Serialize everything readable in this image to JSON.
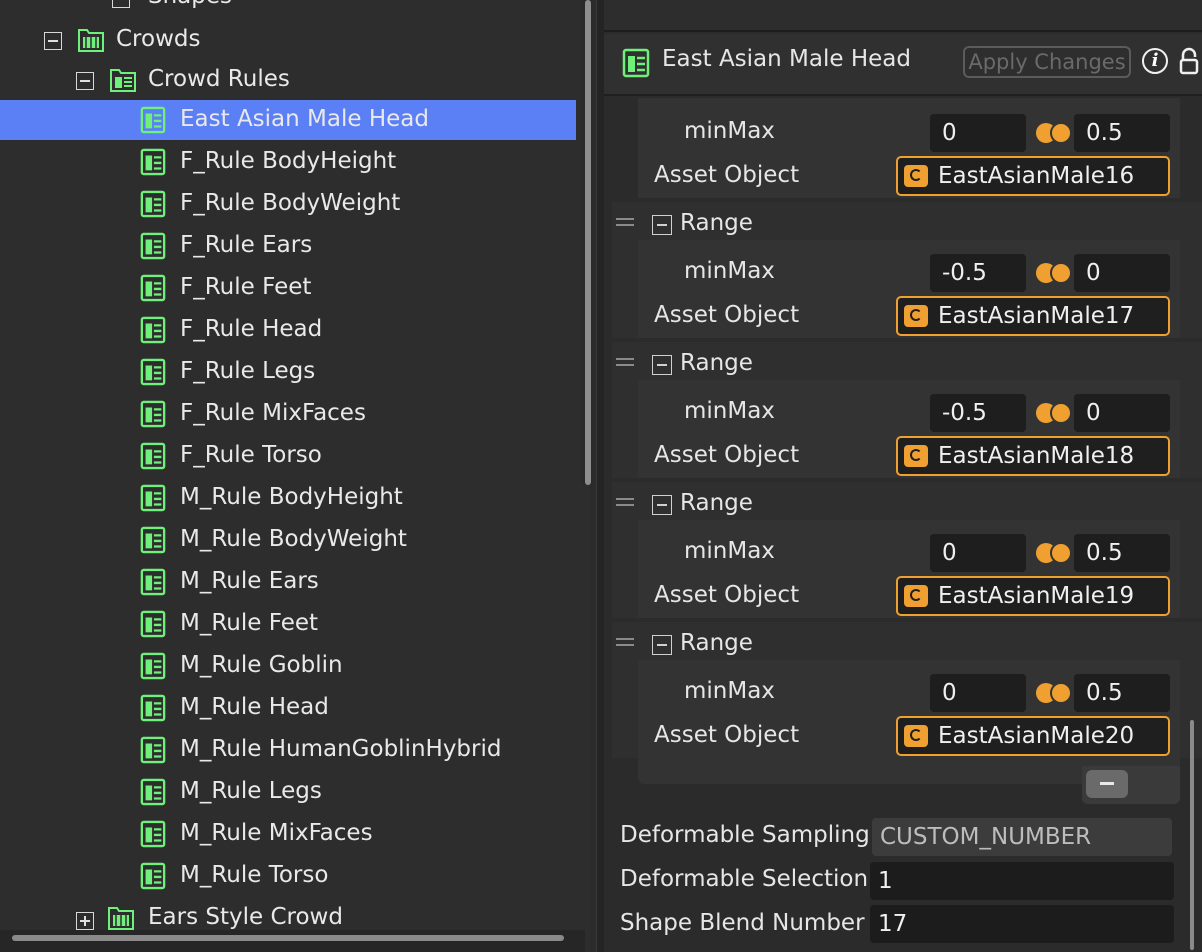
{
  "tree": {
    "partial_top_label": "Shapes",
    "crowds_label": "Crowds",
    "crowd_rules_label": "Crowd Rules",
    "items": [
      "East Asian Male Head",
      "F_Rule BodyHeight",
      "F_Rule BodyWeight",
      "F_Rule Ears",
      "F_Rule Feet",
      "F_Rule Head",
      "F_Rule Legs",
      "F_Rule MixFaces",
      "F_Rule Torso",
      "M_Rule BodyHeight",
      "M_Rule BodyWeight",
      "M_Rule Ears",
      "M_Rule Feet",
      "M_Rule Goblin",
      "M_Rule Head",
      "M_Rule HumanGoblinHybrid",
      "M_Rule Legs",
      "M_Rule MixFaces",
      "M_Rule Torso"
    ],
    "partial_bottom_label": "Ears Style Crowd",
    "selected_index": 0
  },
  "inspector": {
    "title": "East Asian Male Head",
    "apply_label": "Apply Changes",
    "info_glyph": "i",
    "partial_group": {
      "minmax_label": "minMax",
      "min": "0",
      "max": "0.5",
      "asset_label": "Asset Object",
      "asset": "EastAsianMale16"
    },
    "groups": [
      {
        "range_label": "Range",
        "minmax_label": "minMax",
        "min": "-0.5",
        "max": "0",
        "asset_label": "Asset Object",
        "asset": "EastAsianMale17"
      },
      {
        "range_label": "Range",
        "minmax_label": "minMax",
        "min": "-0.5",
        "max": "0",
        "asset_label": "Asset Object",
        "asset": "EastAsianMale18"
      },
      {
        "range_label": "Range",
        "minmax_label": "minMax",
        "min": "0",
        "max": "0.5",
        "asset_label": "Asset Object",
        "asset": "EastAsianMale19"
      },
      {
        "range_label": "Range",
        "minmax_label": "minMax",
        "min": "0",
        "max": "0.5",
        "asset_label": "Asset Object",
        "asset": "EastAsianMale20"
      }
    ],
    "deformable_sampling_label": "Deformable Sampling",
    "deformable_sampling_value": "CUSTOM_NUMBER",
    "deformable_selection_label": "Deformable Selection",
    "deformable_selection_value": "1",
    "shape_blend_label": "Shape Blend Number",
    "shape_blend_value": "17"
  },
  "colors": {
    "selection": "#5b7ff5",
    "accent_orange": "#f0a030",
    "icon_green": "#6ff07a"
  }
}
